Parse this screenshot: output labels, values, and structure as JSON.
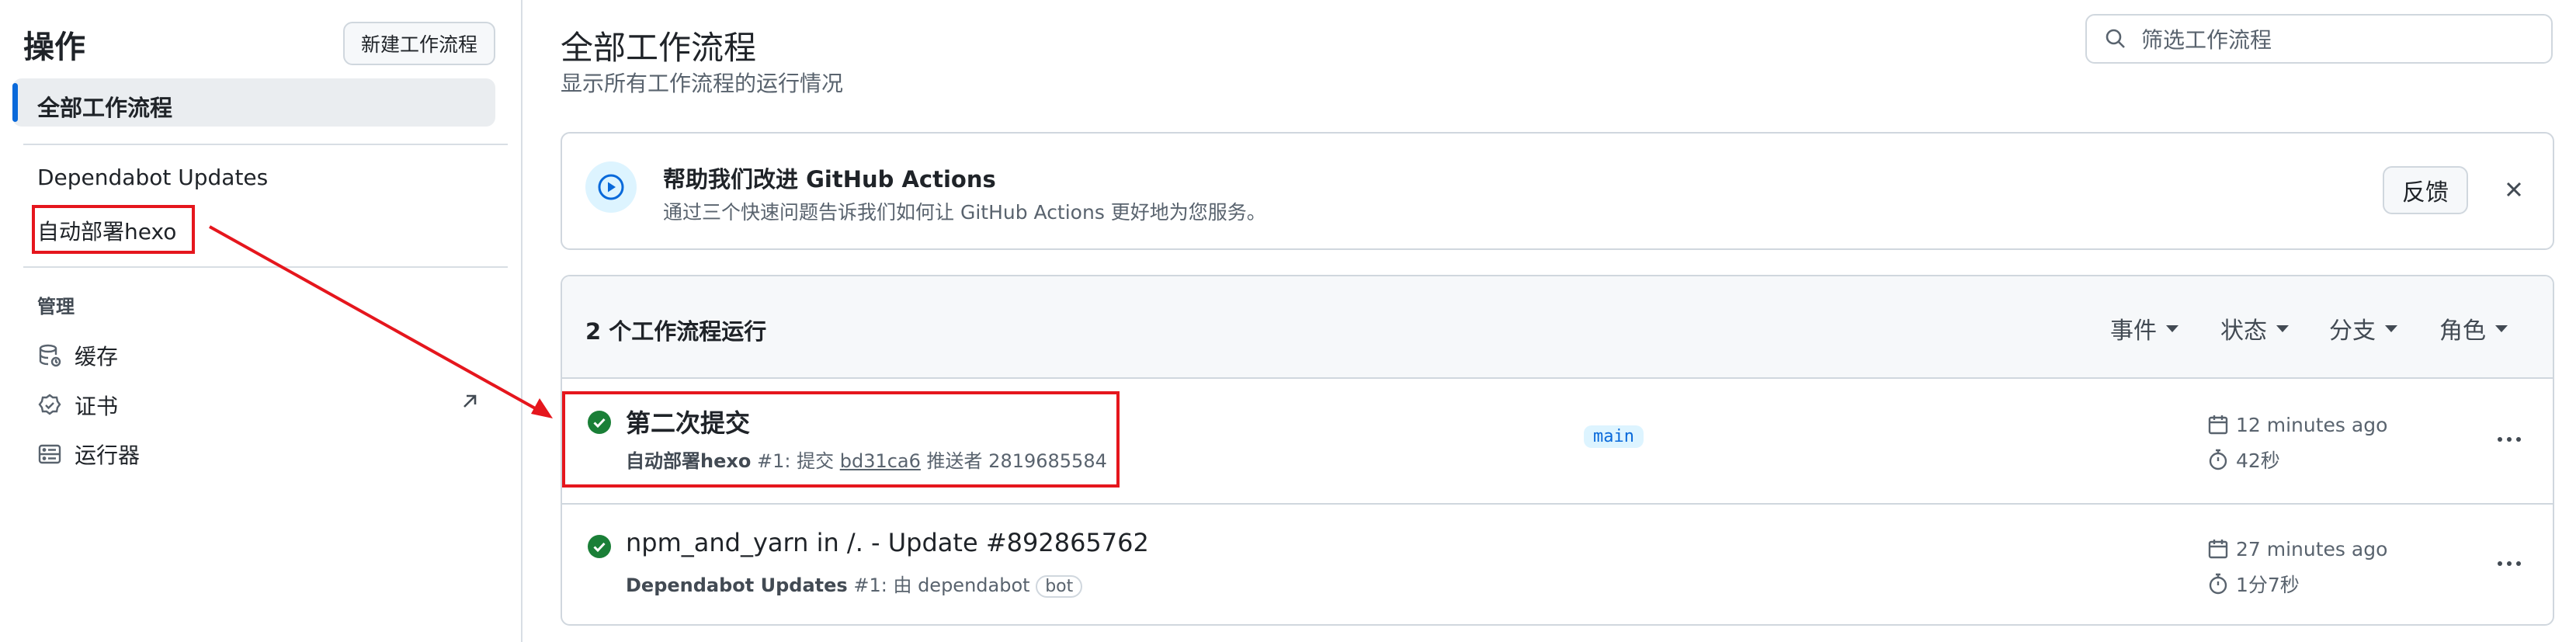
{
  "sidebar": {
    "title": "操作",
    "new_workflow_button": "新建工作流程",
    "all_workflows": "全部工作流程",
    "workflows": [
      "Dependabot Updates",
      "自动部署hexo"
    ],
    "management_heading": "管理",
    "management_items": [
      "缓存",
      "证书",
      "运行器"
    ]
  },
  "header": {
    "title": "全部工作流程",
    "subtitle": "显示所有工作流程的运行情况",
    "filter_placeholder": "筛选工作流程"
  },
  "banner": {
    "title": "帮助我们改进 GitHub Actions",
    "subtitle": "通过三个快速问题告诉我们如何让 GitHub Actions 更好地为您服务。",
    "feedback_button": "反馈"
  },
  "runs": {
    "count_label": "2 个工作流程运行",
    "filters": [
      "事件",
      "状态",
      "分支",
      "角色"
    ],
    "items": [
      {
        "title": "第二次提交",
        "workflow": "自动部署hexo",
        "run_number": "#1: 提交",
        "commit": "bd31ca6",
        "pusher": "推送者 2819685584",
        "branch": "main",
        "time_ago": "12 minutes ago",
        "duration": "42秒",
        "status": "success"
      },
      {
        "title": "npm_and_yarn in /. - Update #892865762",
        "workflow": "Dependabot Updates",
        "run_number": "#1: 由 dependabot",
        "bot_label": "bot",
        "time_ago": "27 minutes ago",
        "duration": "1分7秒",
        "status": "success"
      }
    ]
  },
  "colors": {
    "accent": "#0969da",
    "success": "#1a7f37",
    "annotation": "#e5161d"
  }
}
